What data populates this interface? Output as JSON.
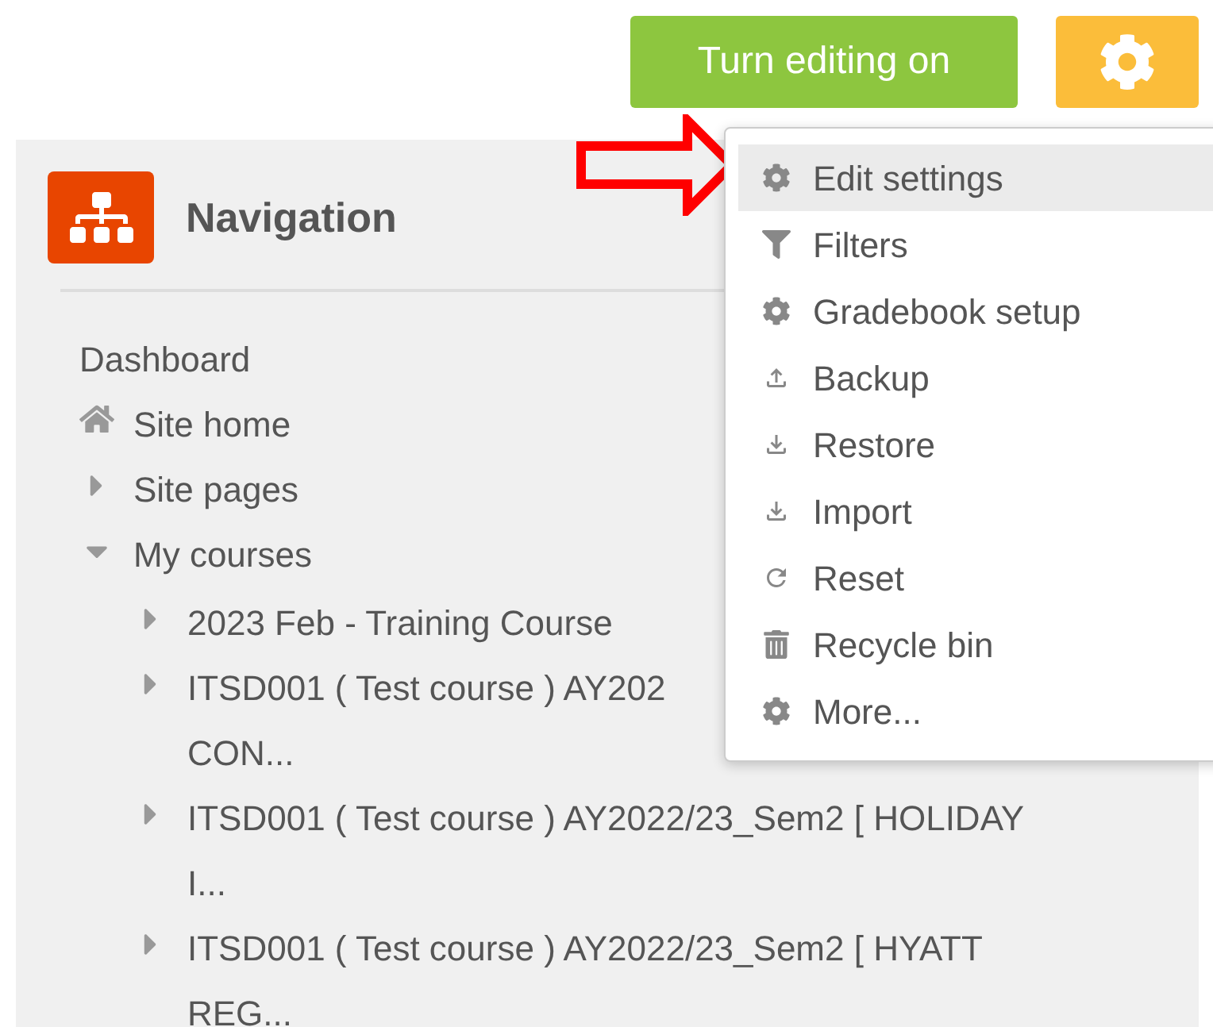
{
  "header": {
    "edit_button": "Turn editing on"
  },
  "navigation": {
    "title": "Navigation",
    "items": [
      {
        "kind": "link",
        "label": [
          "Dashboard"
        ]
      },
      {
        "kind": "home",
        "label": [
          "Site home"
        ]
      },
      {
        "kind": "branch",
        "label": [
          "Site pages"
        ],
        "expanded": false
      },
      {
        "kind": "branch",
        "label": [
          "My courses"
        ],
        "expanded": true,
        "children": [
          {
            "kind": "branch",
            "label": [
              "2023 Feb - Training Course"
            ],
            "expanded": false
          },
          {
            "kind": "branch",
            "label": [
              "ITSD001 ( Test course ) AY202",
              "CON..."
            ],
            "expanded": false
          },
          {
            "kind": "branch",
            "label": [
              "ITSD001 ( Test course ) AY2022/23_Sem2 [ HOLIDAY",
              "I..."
            ],
            "expanded": false
          },
          {
            "kind": "branch",
            "label": [
              "ITSD001 ( Test course ) AY2022/23_Sem2 [ HYATT",
              "REG..."
            ],
            "expanded": false
          }
        ]
      }
    ]
  },
  "menu": {
    "items": [
      {
        "kind": "gear",
        "label": "Edit settings",
        "selected": true
      },
      {
        "kind": "filter",
        "label": "Filters",
        "selected": false
      },
      {
        "kind": "gear",
        "label": "Gradebook setup",
        "selected": false
      },
      {
        "kind": "upload",
        "label": "Backup",
        "selected": false
      },
      {
        "kind": "download",
        "label": "Restore",
        "selected": false
      },
      {
        "kind": "download",
        "label": "Import",
        "selected": false
      },
      {
        "kind": "reset",
        "label": "Reset",
        "selected": false
      },
      {
        "kind": "trash",
        "label": "Recycle bin",
        "selected": false
      },
      {
        "kind": "gear",
        "label": "More...",
        "selected": false
      }
    ]
  }
}
